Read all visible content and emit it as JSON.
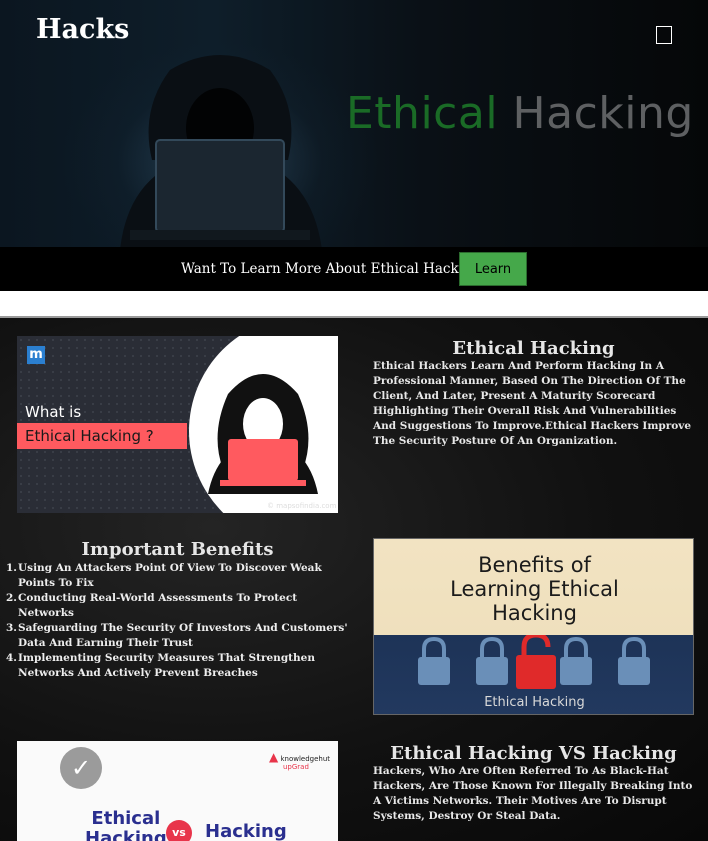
{
  "header": {
    "brand": "Hacks",
    "menu_icon": "menu-icon",
    "hero_title_part1": "Ethical",
    "hero_title_part2": "Hacking"
  },
  "cta": {
    "text": "Want To Learn More About Ethical Hacking!!",
    "button_label": "Learn",
    "button_color": "#45a84a"
  },
  "section_intro": {
    "image": {
      "logo_letter": "m",
      "line1": "What is",
      "line2": "Ethical Hacking ?",
      "credit": "© mapsofindia.com"
    },
    "title": "Ethical Hacking",
    "body": "Ethical Hackers Learn And Perform Hacking In A Professional Manner, Based On The Direction Of The Client, And Later, Present A Maturity Scorecard Highlighting Their Overall Risk And Vulnerabilities And Suggestions To Improve.Ethical Hackers Improve The Security Posture Of An Organization."
  },
  "section_benefits": {
    "title": "Important Benefits",
    "items": [
      "Using An Attackers Point Of View To Discover Weak Points To Fix",
      "Conducting Real-World Assessments To Protect Networks",
      "Safeguarding The Security Of Investors And Customers' Data And Earning Their Trust",
      "Implementing Security Measures That Strengthen Networks And Actively Prevent Breaches"
    ],
    "image": {
      "line1": "Benefits of",
      "line2": "Learning Ethical",
      "line3": "Hacking",
      "footer": "Ethical Hacking"
    }
  },
  "section_vs": {
    "image": {
      "brand": "knowledgehut",
      "brand_sub": "upGrad",
      "left_word_1": "Ethical",
      "left_word_2": "Hacking",
      "vs": "vs",
      "right_word": "Hacking"
    },
    "title": "Ethical Hacking VS Hacking",
    "body": "Hackers, Who Are Often Referred To As Black-Hat Hackers, Are Those Known For Illegally Breaking Into A Victims Networks. Their Motives Are To Disrupt Systems, Destroy Or Steal Data."
  }
}
